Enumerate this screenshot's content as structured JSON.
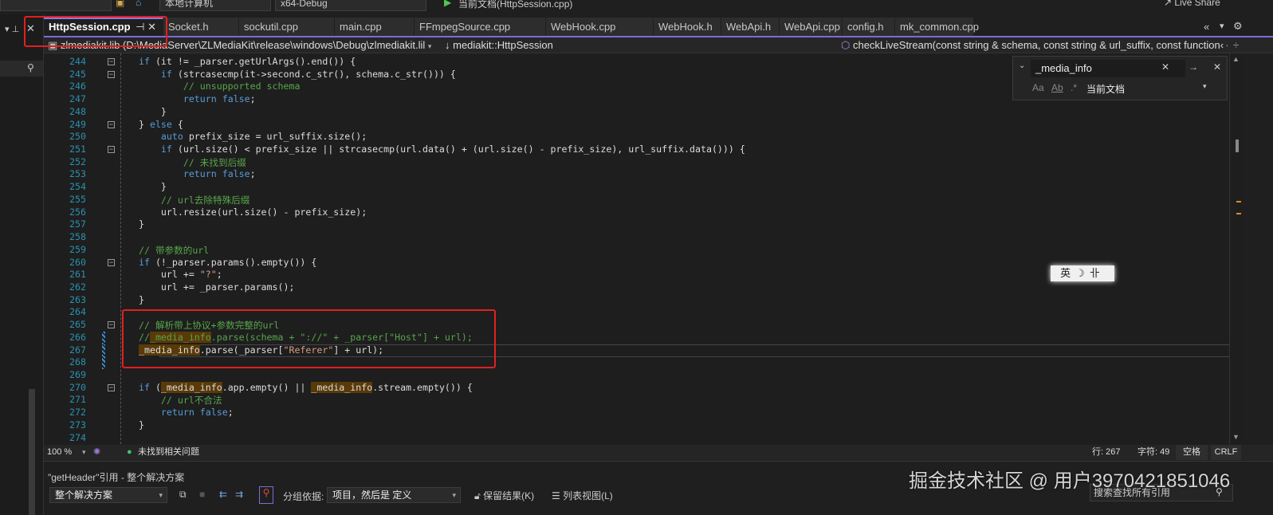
{
  "toolbar": {
    "target": "本地计算机",
    "config": "x64-Debug",
    "run": "当前文档(HttpSession.cpp)",
    "live_share": "Live Share"
  },
  "tabs": [
    {
      "label": "HttpSession.cpp",
      "active": true
    },
    {
      "label": "Socket.h"
    },
    {
      "label": "sockutil.cpp"
    },
    {
      "label": "main.cpp"
    },
    {
      "label": "FFmpegSource.cpp"
    },
    {
      "label": "WebHook.cpp"
    },
    {
      "label": "WebHook.h"
    },
    {
      "label": "WebApi.h"
    },
    {
      "label": "WebApi.cpp"
    },
    {
      "label": "config.h"
    },
    {
      "label": "mk_common.cpp"
    }
  ],
  "navbar": {
    "project": "zlmediakit.lib (D:\\MediaServer\\ZLMediaKit\\release\\windows\\Debug\\zlmediakit.lil",
    "scope": "↓ mediakit::HttpSession",
    "member": "checkLiveStream(const string & schema, const string & url_suffix, const function‹"
  },
  "find": {
    "query": "_media_info",
    "scope": "当前文档"
  },
  "highlight_term": "_media_info",
  "colors": {
    "accent": "#7d6bd8",
    "keyword": "#569cd6",
    "comment": "#57a64a",
    "string": "#d69d85",
    "line_number": "#2b91af",
    "annotation": "#e02020"
  },
  "code": {
    "current_line": 267,
    "lines": [
      {
        "n": "244",
        "t": "if (it != _parser.getUrlArgs().end()) {",
        "fold": true
      },
      {
        "n": "245",
        "t": "    if (strcasecmp(it->second.c_str(), schema.c_str())) {",
        "fold": true
      },
      {
        "n": "246",
        "t": "        // unsupported schema"
      },
      {
        "n": "247",
        "t": "        return false;"
      },
      {
        "n": "248",
        "t": "    }"
      },
      {
        "n": "249",
        "t": "} else {",
        "fold": true
      },
      {
        "n": "250",
        "t": "    auto prefix_size = url_suffix.size();"
      },
      {
        "n": "251",
        "t": "    if (url.size() < prefix_size || strcasecmp(url.data() + (url.size() - prefix_size), url_suffix.data())) {",
        "fold": true
      },
      {
        "n": "252",
        "t": "        // 未找到后缀"
      },
      {
        "n": "253",
        "t": "        return false;"
      },
      {
        "n": "254",
        "t": "    }"
      },
      {
        "n": "255",
        "t": "    // url去除特殊后缀"
      },
      {
        "n": "256",
        "t": "    url.resize(url.size() - prefix_size);"
      },
      {
        "n": "257",
        "t": "}"
      },
      {
        "n": "258",
        "t": ""
      },
      {
        "n": "259",
        "t": "// 带参数的url"
      },
      {
        "n": "260",
        "t": "if (!_parser.params().empty()) {",
        "fold": true
      },
      {
        "n": "261",
        "t": "    url += \"?\";"
      },
      {
        "n": "262",
        "t": "    url += _parser.params();"
      },
      {
        "n": "263",
        "t": "}"
      },
      {
        "n": "264",
        "t": ""
      },
      {
        "n": "265",
        "t": "// 解析带上协议+参数完整的url",
        "fold": true
      },
      {
        "n": "266",
        "t": "//_media_info.parse(schema + \"://\" + _parser[\"Host\"] + url);",
        "changed": true
      },
      {
        "n": "267",
        "t": "_media_info.parse(_parser[\"Referer\"] + url);",
        "changed": true
      },
      {
        "n": "268",
        "t": "",
        "changed": true
      },
      {
        "n": "269",
        "t": ""
      },
      {
        "n": "270",
        "t": "if (_media_info.app.empty() || _media_info.stream.empty()) {",
        "fold": true
      },
      {
        "n": "271",
        "t": "    // url不合法"
      },
      {
        "n": "272",
        "t": "    return false;"
      },
      {
        "n": "273",
        "t": "}"
      },
      {
        "n": "274",
        "t": ""
      }
    ]
  },
  "ime": {
    "lang": "英",
    "mode": "☽",
    "width": "卝"
  },
  "status": {
    "zoom": "100 %",
    "issues": "未找到相关问题",
    "line": "行: 267",
    "col": "字符: 49",
    "indent": "空格",
    "eol": "CRLF"
  },
  "refs": {
    "title": "\"getHeader\"引用 - 整个解决方案",
    "scope": "整个解决方案",
    "group_label": "分组依据:",
    "group_value": "项目，然后是 定义",
    "keep": "保留结果(K)",
    "list_view": "列表视图(L)",
    "search_placeholder": "搜索查找所有引用"
  },
  "watermark": "掘金技术社区 @ 用户3970421851046"
}
